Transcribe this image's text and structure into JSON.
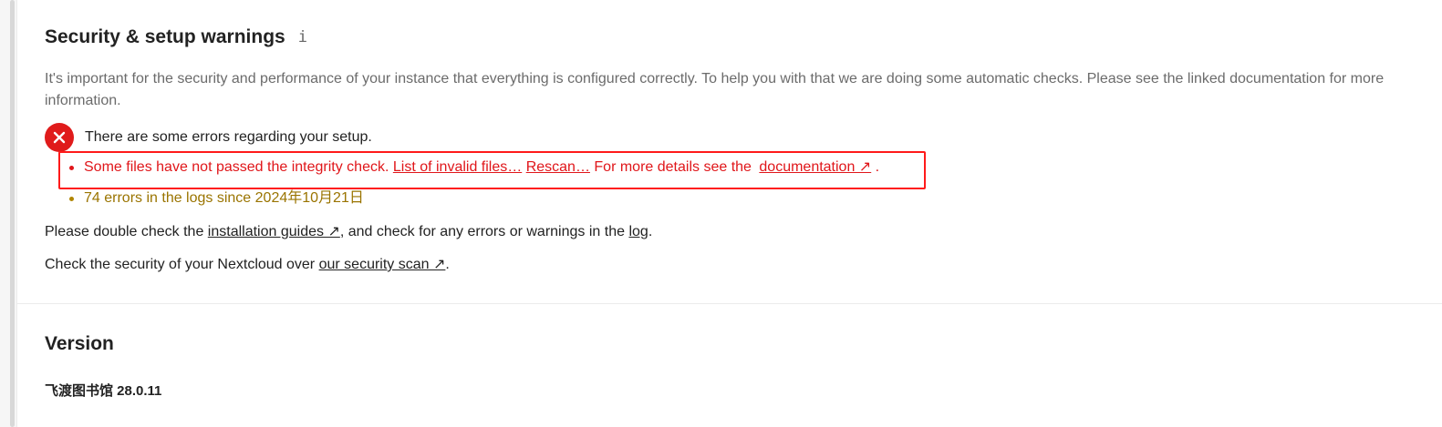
{
  "security": {
    "title": "Security & setup warnings",
    "info_icon": "info-icon",
    "info_glyph": "i",
    "description": "It's important for the security and performance of your instance that everything is configured correctly. To help you with that we are doing some automatic checks. Please see the linked documentation for more information.",
    "error_summary": "There are some errors regarding your setup.",
    "integrity": {
      "text": "Some files have not passed the integrity check.",
      "invalid_files_link": "List of invalid files…",
      "rescan_link": "Rescan…",
      "details_text": "For more details see the",
      "documentation_link": "documentation ↗",
      "end": "."
    },
    "log_warning": "74 errors in the logs since 2024年10月21日",
    "double_check": {
      "prefix": "Please double check the",
      "guides_link": "installation guides ↗",
      "middle": ", and check for any errors or warnings in the",
      "log_link": "log",
      "suffix": "."
    },
    "security_scan": {
      "prefix": "Check the security of your Nextcloud over",
      "scan_link": "our security scan ↗",
      "suffix": "."
    },
    "colors": {
      "error": "#e0161a",
      "warning": "#9a7400",
      "highlight": "#ff1a1a"
    }
  },
  "version": {
    "title": "Version",
    "value": "飞渡图书馆 28.0.11"
  }
}
